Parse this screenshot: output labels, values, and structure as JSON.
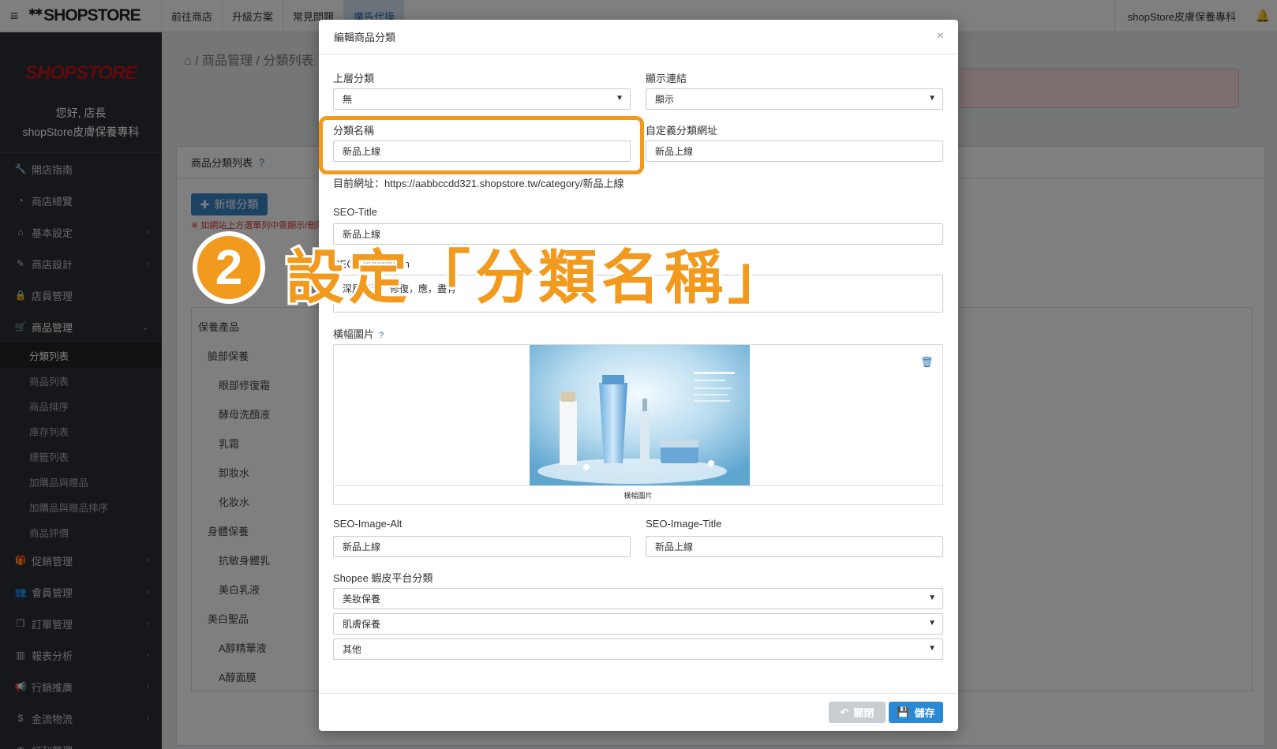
{
  "topbar": {
    "logo": "SHOPSTORE",
    "nav": [
      "前往商店",
      "升級方案",
      "常見問題",
      "廣告代操"
    ],
    "store_name": "shopStore皮膚保養專科"
  },
  "sidebar": {
    "logo": "SHOPSTORE",
    "greeting": "您好, 店長",
    "store_name": "shopStore皮膚保養專科",
    "items_top": [
      "開店指南",
      "商店總覽",
      "基本設定",
      "商店設計",
      "店員管理",
      "商品管理"
    ],
    "sub_items": [
      "分類列表",
      "商品列表",
      "商品排序",
      "庫存列表",
      "標籤列表",
      "加購品與贈品",
      "加購品與贈品排序",
      "商品評價"
    ],
    "items_bottom": [
      "促銷管理",
      "會員管理",
      "訂單管理",
      "報表分析",
      "行銷推廣",
      "金流物流",
      "紅利管理"
    ]
  },
  "content": {
    "breadcrumb": "/ 商品管理 / 分類列表",
    "panel_title": "商品分類列表",
    "add_button": "新增分類",
    "warning": "※ 如網站上方選單列中需顯示/刪除",
    "tree": [
      "保養產品",
      "臉部保養",
      "眼部修復霜",
      "酵母洗顏液",
      "乳霜",
      "卸妝水",
      "化妝水",
      "身體保養",
      "抗敏身體乳",
      "美白乳液",
      "美白聖品",
      "A醇精華液",
      "A醇面膜"
    ]
  },
  "modal": {
    "title": "編輯商品分類",
    "close": "×",
    "parent_label": "上層分類",
    "parent_value": "無",
    "display_label": "顯示連結",
    "display_value": "顯示",
    "name_label": "分類名稱",
    "name_value": "新品上線",
    "custom_url_label": "自定義分類網址",
    "custom_url_value": "新品上線",
    "current_url": "目前網址：https://aabbccdd321.shopstore.tw/category/新品上線",
    "seo_title_label": "SEO-Title",
    "seo_title_value": "新品上線",
    "seo_desc_label": "SEO-Description",
    "seo_desc_value": "深層清潔，修復，應，盡有",
    "banner_label": "橫幅圖片",
    "banner_caption": "橫幅圖片",
    "seo_img_alt_label": "SEO-Image-Alt",
    "seo_img_alt_value": "新品上線",
    "seo_img_title_label": "SEO-Image-Title",
    "seo_img_title_value": "新品上線",
    "shopee_label": "Shopee 蝦皮平台分類",
    "shopee_1": "美妝保養",
    "shopee_2": "肌膚保養",
    "shopee_3": "其他",
    "close_button": "關閉",
    "save_button": "儲存"
  },
  "annotation": {
    "step": "2",
    "text": "設定「分類名稱」",
    "color": "#f29a1e"
  }
}
